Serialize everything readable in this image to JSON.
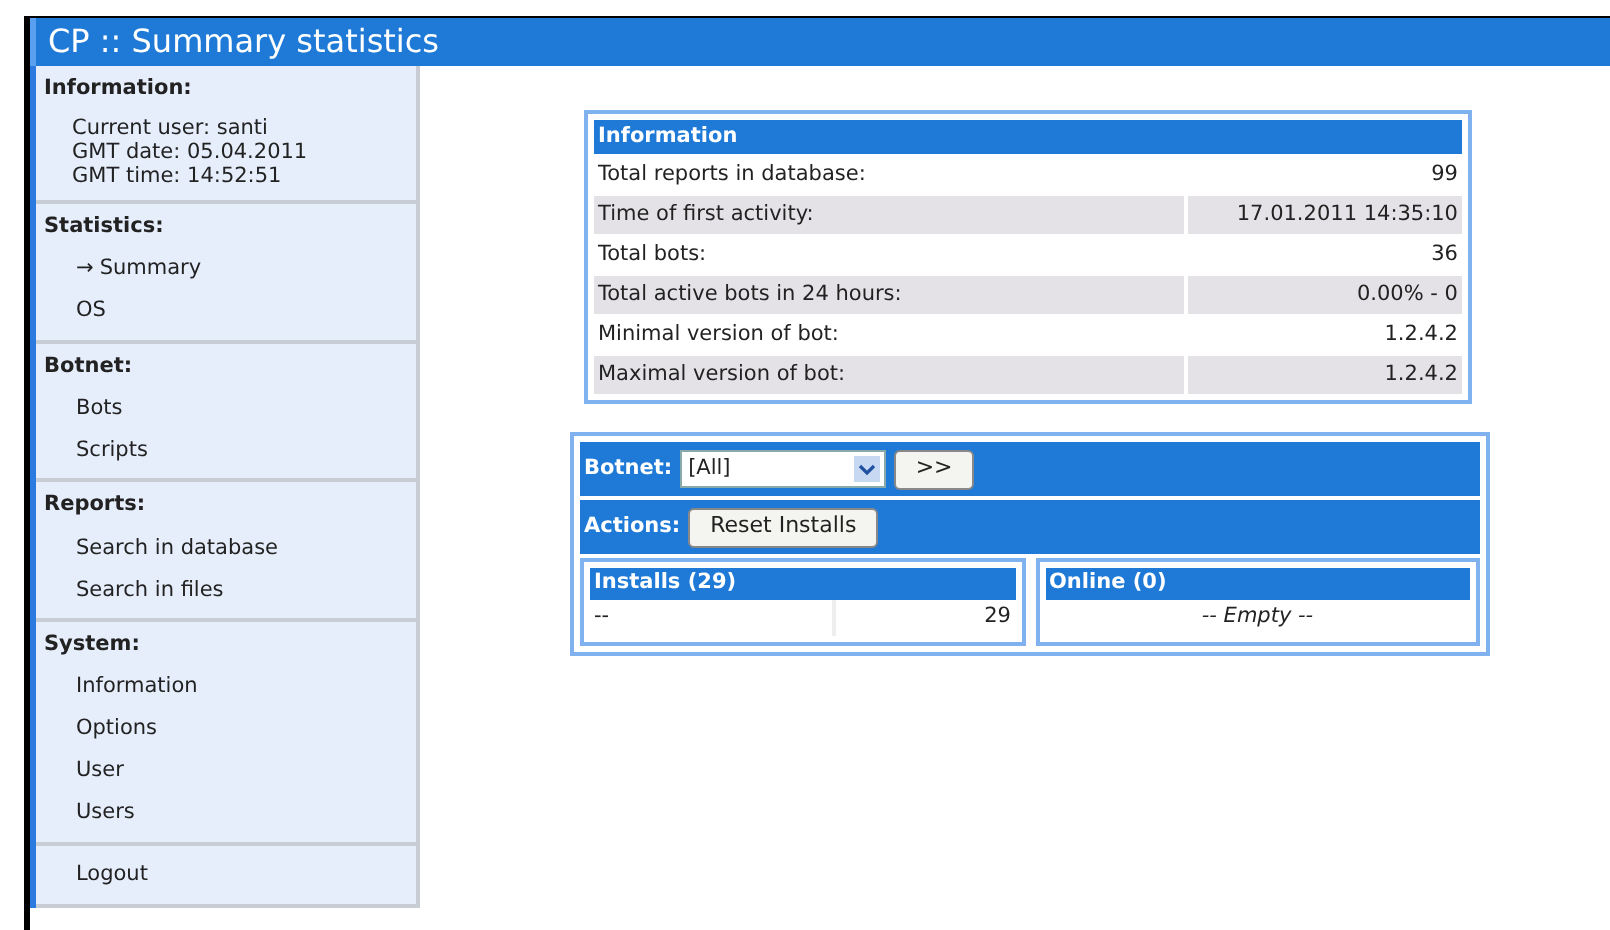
{
  "window": {
    "title": "CP :: Summary statistics"
  },
  "sidebar": {
    "selected_marker": "→",
    "sections": [
      {
        "title": "Information:",
        "kind": "info",
        "lines": [
          "Current user: santi",
          "GMT date: 05.04.2011",
          "GMT time: 14:52:51"
        ]
      },
      {
        "title": "Statistics:",
        "kind": "links",
        "items": [
          {
            "label": "Summary",
            "selected": true
          },
          {
            "label": "OS",
            "selected": false
          }
        ]
      },
      {
        "title": "Botnet:",
        "kind": "links",
        "items": [
          {
            "label": "Bots",
            "selected": false
          },
          {
            "label": "Scripts",
            "selected": false
          }
        ]
      },
      {
        "title": "Reports:",
        "kind": "links",
        "items": [
          {
            "label": "Search in database",
            "selected": false
          },
          {
            "label": "Search in files",
            "selected": false
          }
        ]
      },
      {
        "title": "System:",
        "kind": "links",
        "items": [
          {
            "label": "Information",
            "selected": false
          },
          {
            "label": "Options",
            "selected": false
          },
          {
            "label": "User",
            "selected": false
          },
          {
            "label": "Users",
            "selected": false
          }
        ]
      },
      {
        "kind": "links",
        "items": [
          {
            "label": "Logout",
            "selected": false
          }
        ]
      }
    ]
  },
  "information": {
    "title": "Information",
    "rows": [
      {
        "label": "Total reports in database:",
        "value": "99"
      },
      {
        "label": "Time of first activity:",
        "value": "17.01.2011 14:35:10"
      },
      {
        "label": "Total bots:",
        "value": "36"
      },
      {
        "label": "Total active bots in 24 hours:",
        "value": "0.00% - 0"
      },
      {
        "label": "Minimal version of bot:",
        "value": "1.2.4.2"
      },
      {
        "label": "Maximal version of bot:",
        "value": "1.2.4.2"
      }
    ]
  },
  "botnet_panel": {
    "botnet_label": "Botnet:",
    "botnet_value": "[All]",
    "go_button": ">>",
    "actions_label": "Actions:",
    "reset_button": "Reset Installs",
    "installs": {
      "title": "Installs (29)",
      "rows": [
        {
          "column_1": "--",
          "column_2": "29"
        }
      ]
    },
    "online": {
      "title": "Online (0)",
      "empty_text": "-- Empty --"
    }
  }
}
